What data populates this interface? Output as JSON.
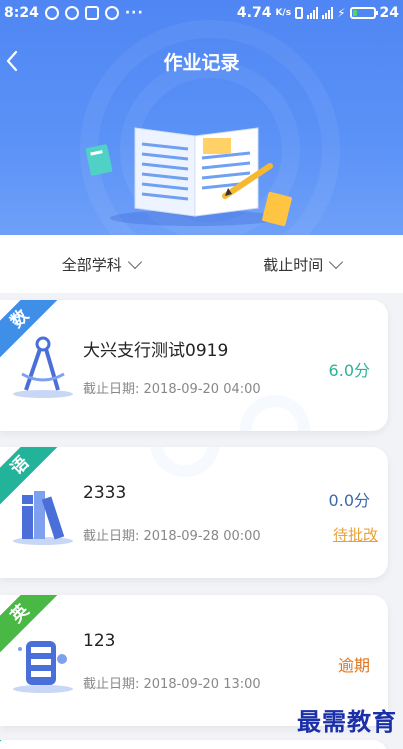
{
  "status_bar": {
    "time": "8:24",
    "speed": "4.74",
    "speed_unit": "K/s",
    "battery": "24",
    "battery_level": 0.24,
    "dots": "···"
  },
  "header": {
    "title": "作业记录"
  },
  "filters": [
    {
      "label": "全部学科"
    },
    {
      "label": "截止时间"
    }
  ],
  "records": [
    {
      "subject": "数",
      "subject_color": "#3f8ee8",
      "name": "大兴支行测试0919",
      "deadline": "截止日期:  2018-09-20 04:00",
      "score": "6.0分",
      "score_color": "#2bb39a",
      "status": "",
      "icon": "compass-icon"
    },
    {
      "subject": "语",
      "subject_color": "#23b39b",
      "name": "2333",
      "deadline": "截止日期:  2018-09-28 00:00",
      "score": "0.0分",
      "score_color": "#3b6aa8",
      "status": "待批改",
      "status_color": "#e8a23a",
      "icon": "books-icon"
    },
    {
      "subject": "英",
      "subject_color": "#4ab845",
      "name": "123",
      "deadline": "截止日期:  2018-09-20 13:00",
      "score": "",
      "status": "逾期",
      "status_color": "#e07520",
      "icon": "robot-icon"
    }
  ],
  "watermark": "最需教育"
}
